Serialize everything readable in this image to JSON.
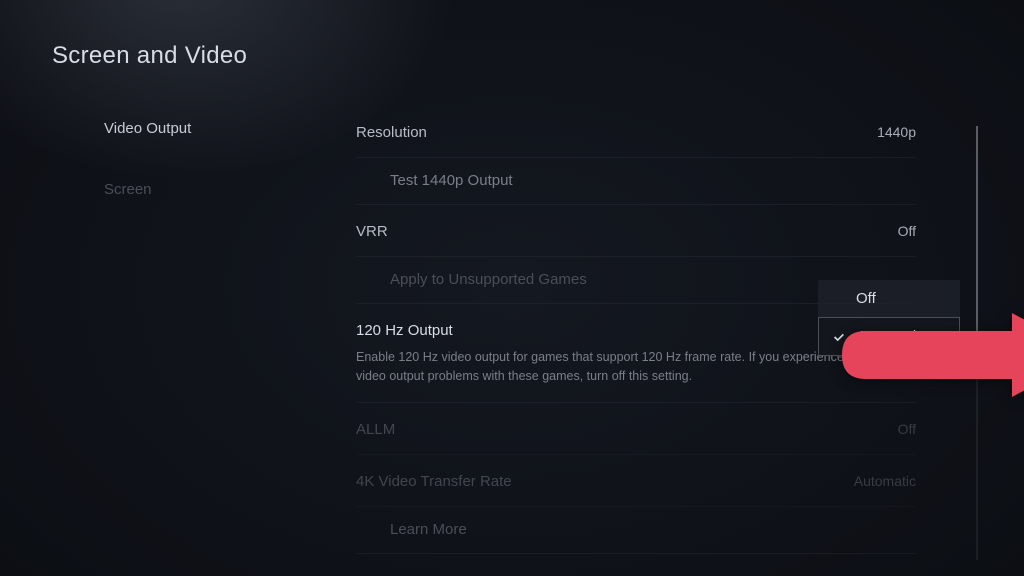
{
  "page_title": "Screen and Video",
  "sidebar": {
    "items": [
      {
        "label": "Video Output",
        "active": true
      },
      {
        "label": "Screen",
        "active": false
      }
    ]
  },
  "settings": {
    "resolution": {
      "label": "Resolution",
      "value": "1440p"
    },
    "test_1440p": {
      "label": "Test 1440p Output"
    },
    "vrr": {
      "label": "VRR",
      "value": "Off"
    },
    "vrr_unsupported": {
      "label": "Apply to Unsupported Games"
    },
    "hz_output": {
      "label": "120 Hz Output",
      "description": "Enable 120 Hz video output for games that support 120 Hz frame rate. If you experience video output problems with these games, turn off this setting."
    },
    "allm": {
      "label": "ALLM",
      "value": "Off"
    },
    "transfer_rate": {
      "label": "4K Video Transfer Rate",
      "value": "Automatic"
    },
    "learn_more": {
      "label": "Learn More"
    }
  },
  "dropdown": {
    "options": [
      {
        "label": "Off",
        "selected": false
      },
      {
        "label": "Automatic",
        "selected": true
      }
    ]
  },
  "colors": {
    "arrow": "#e6445a"
  }
}
